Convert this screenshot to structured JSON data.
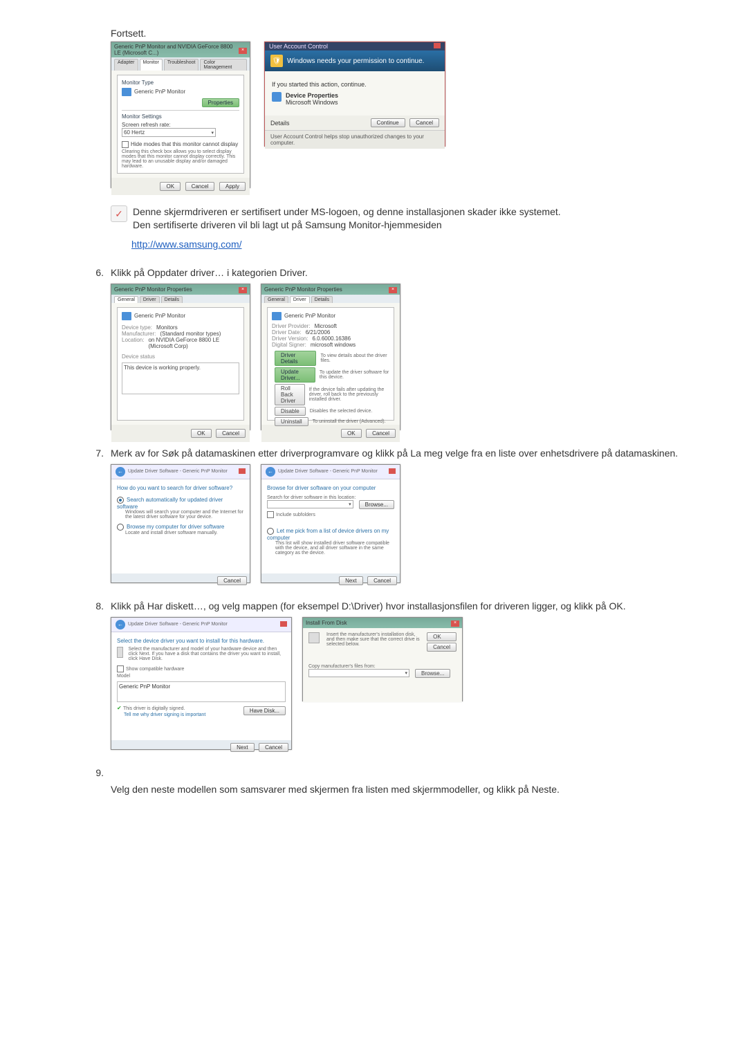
{
  "intro": "Fortsett.",
  "dialog1": {
    "title": "Generic PnP Monitor and NVIDIA GeForce 8800 LE (Microsoft C...)",
    "tabs": [
      "Adapter",
      "Monitor",
      "Troubleshoot",
      "Color Management"
    ],
    "monitor_type_label": "Monitor Type",
    "monitor_name": "Generic PnP Monitor",
    "properties_btn": "Properties",
    "monitor_settings_label": "Monitor Settings",
    "refresh_label": "Screen refresh rate:",
    "refresh_value": "60 Hertz",
    "hide_modes_label": "Hide modes that this monitor cannot display",
    "hide_modes_note": "Clearing this check box allows you to select display modes that this monitor cannot display correctly. This may lead to an unusable display and/or damaged hardware.",
    "ok": "OK",
    "cancel": "Cancel",
    "apply": "Apply"
  },
  "uac": {
    "top": "User Account Control",
    "header": "Windows needs your permission to continue.",
    "line1": "If you started this action, continue.",
    "app1": "Device Properties",
    "app2": "Microsoft Windows",
    "details": "Details",
    "continue": "Continue",
    "cancel": "Cancel",
    "footer": "User Account Control helps stop unauthorized changes to your computer."
  },
  "note": {
    "p1": "Denne skjermdriveren er sertifisert under MS-logoen, og denne installasjonen skader ikke systemet.",
    "p2": "Den sertifiserte driveren vil bli lagt ut på Samsung Monitor-hjemmesiden"
  },
  "url": "http://www.samsung.com/",
  "step6": "Klikk på Oppdater driver… i kategorien Driver.",
  "step7": "Merk av for Søk på datamaskinen etter driverprogramvare og klikk på La meg velge fra en liste over enhetsdrivere på datamaskinen.",
  "step8": "Klikk på Har diskett…, og velg mappen (for eksempel D:\\Driver) hvor installasjonsfilen for driveren ligger, og klikk på OK.",
  "step9": "Velg den neste modellen som samsvarer med skjermen fra listen med skjermmodeller, og klikk på Neste.",
  "props_general": {
    "title": "Generic PnP Monitor Properties",
    "tabs": [
      "General",
      "Driver",
      "Details"
    ],
    "name": "Generic PnP Monitor",
    "dev_type_l": "Device type:",
    "dev_type_v": "Monitors",
    "manu_l": "Manufacturer:",
    "manu_v": "(Standard monitor types)",
    "loc_l": "Location:",
    "loc_v": "on NVIDIA GeForce 8800 LE (Microsoft Corp)",
    "status_l": "Device status",
    "status_v": "This device is working properly.",
    "ok": "OK",
    "cancel": "Cancel"
  },
  "props_driver": {
    "title": "Generic PnP Monitor Properties",
    "tabs": [
      "General",
      "Driver",
      "Details"
    ],
    "name": "Generic PnP Monitor",
    "provider_l": "Driver Provider:",
    "provider_v": "Microsoft",
    "date_l": "Driver Date:",
    "date_v": "6/21/2006",
    "ver_l": "Driver Version:",
    "ver_v": "6.0.6000.16386",
    "signer_l": "Digital Signer:",
    "signer_v": "microsoft windows",
    "btn1": "Driver Details",
    "btn1_d": "To view details about the driver files.",
    "btn2": "Update Driver...",
    "btn2_d": "To update the driver software for this device.",
    "btn3": "Roll Back Driver",
    "btn3_d": "If the device fails after updating the driver, roll back to the previously installed driver.",
    "btn4": "Disable",
    "btn4_d": "Disables the selected device.",
    "btn5": "Uninstall",
    "btn5_d": "To uninstall the driver (Advanced).",
    "ok": "OK",
    "cancel": "Cancel"
  },
  "wiz1": {
    "crumb": "Update Driver Software - Generic PnP Monitor",
    "heading": "How do you want to search for driver software?",
    "opt1": "Search automatically for updated driver software",
    "opt1_d": "Windows will search your computer and the Internet for the latest driver software for your device.",
    "opt2": "Browse my computer for driver software",
    "opt2_d": "Locate and install driver software manually.",
    "cancel": "Cancel"
  },
  "wiz2": {
    "crumb": "Update Driver Software - Generic PnP Monitor",
    "heading": "Browse for driver software on your computer",
    "search_l": "Search for driver software in this location:",
    "path": "",
    "browse": "Browse...",
    "include": "Include subfolders",
    "pick": "Let me pick from a list of device drivers on my computer",
    "pick_d": "This list will show installed driver software compatible with the device, and all driver software in the same category as the device.",
    "next": "Next",
    "cancel": "Cancel"
  },
  "wiz3": {
    "crumb": "Update Driver Software - Generic PnP Monitor",
    "heading": "Select the device driver you want to install for this hardware.",
    "sub": "Select the manufacturer and model of your hardware device and then click Next. If you have a disk that contains the driver you want to install, click Have Disk.",
    "compat": "Show compatible hardware",
    "model_l": "Model",
    "model_v": "Generic PnP Monitor",
    "signed": "This driver is digitally signed.",
    "tell": "Tell me why driver signing is important",
    "have_disk": "Have Disk...",
    "next": "Next",
    "cancel": "Cancel"
  },
  "install_disk": {
    "title": "Install From Disk",
    "msg": "Insert the manufacturer's installation disk, and then make sure that the correct drive is selected below.",
    "ok": "OK",
    "cancel": "Cancel",
    "copy_l": "Copy manufacturer's files from:",
    "browse": "Browse..."
  }
}
